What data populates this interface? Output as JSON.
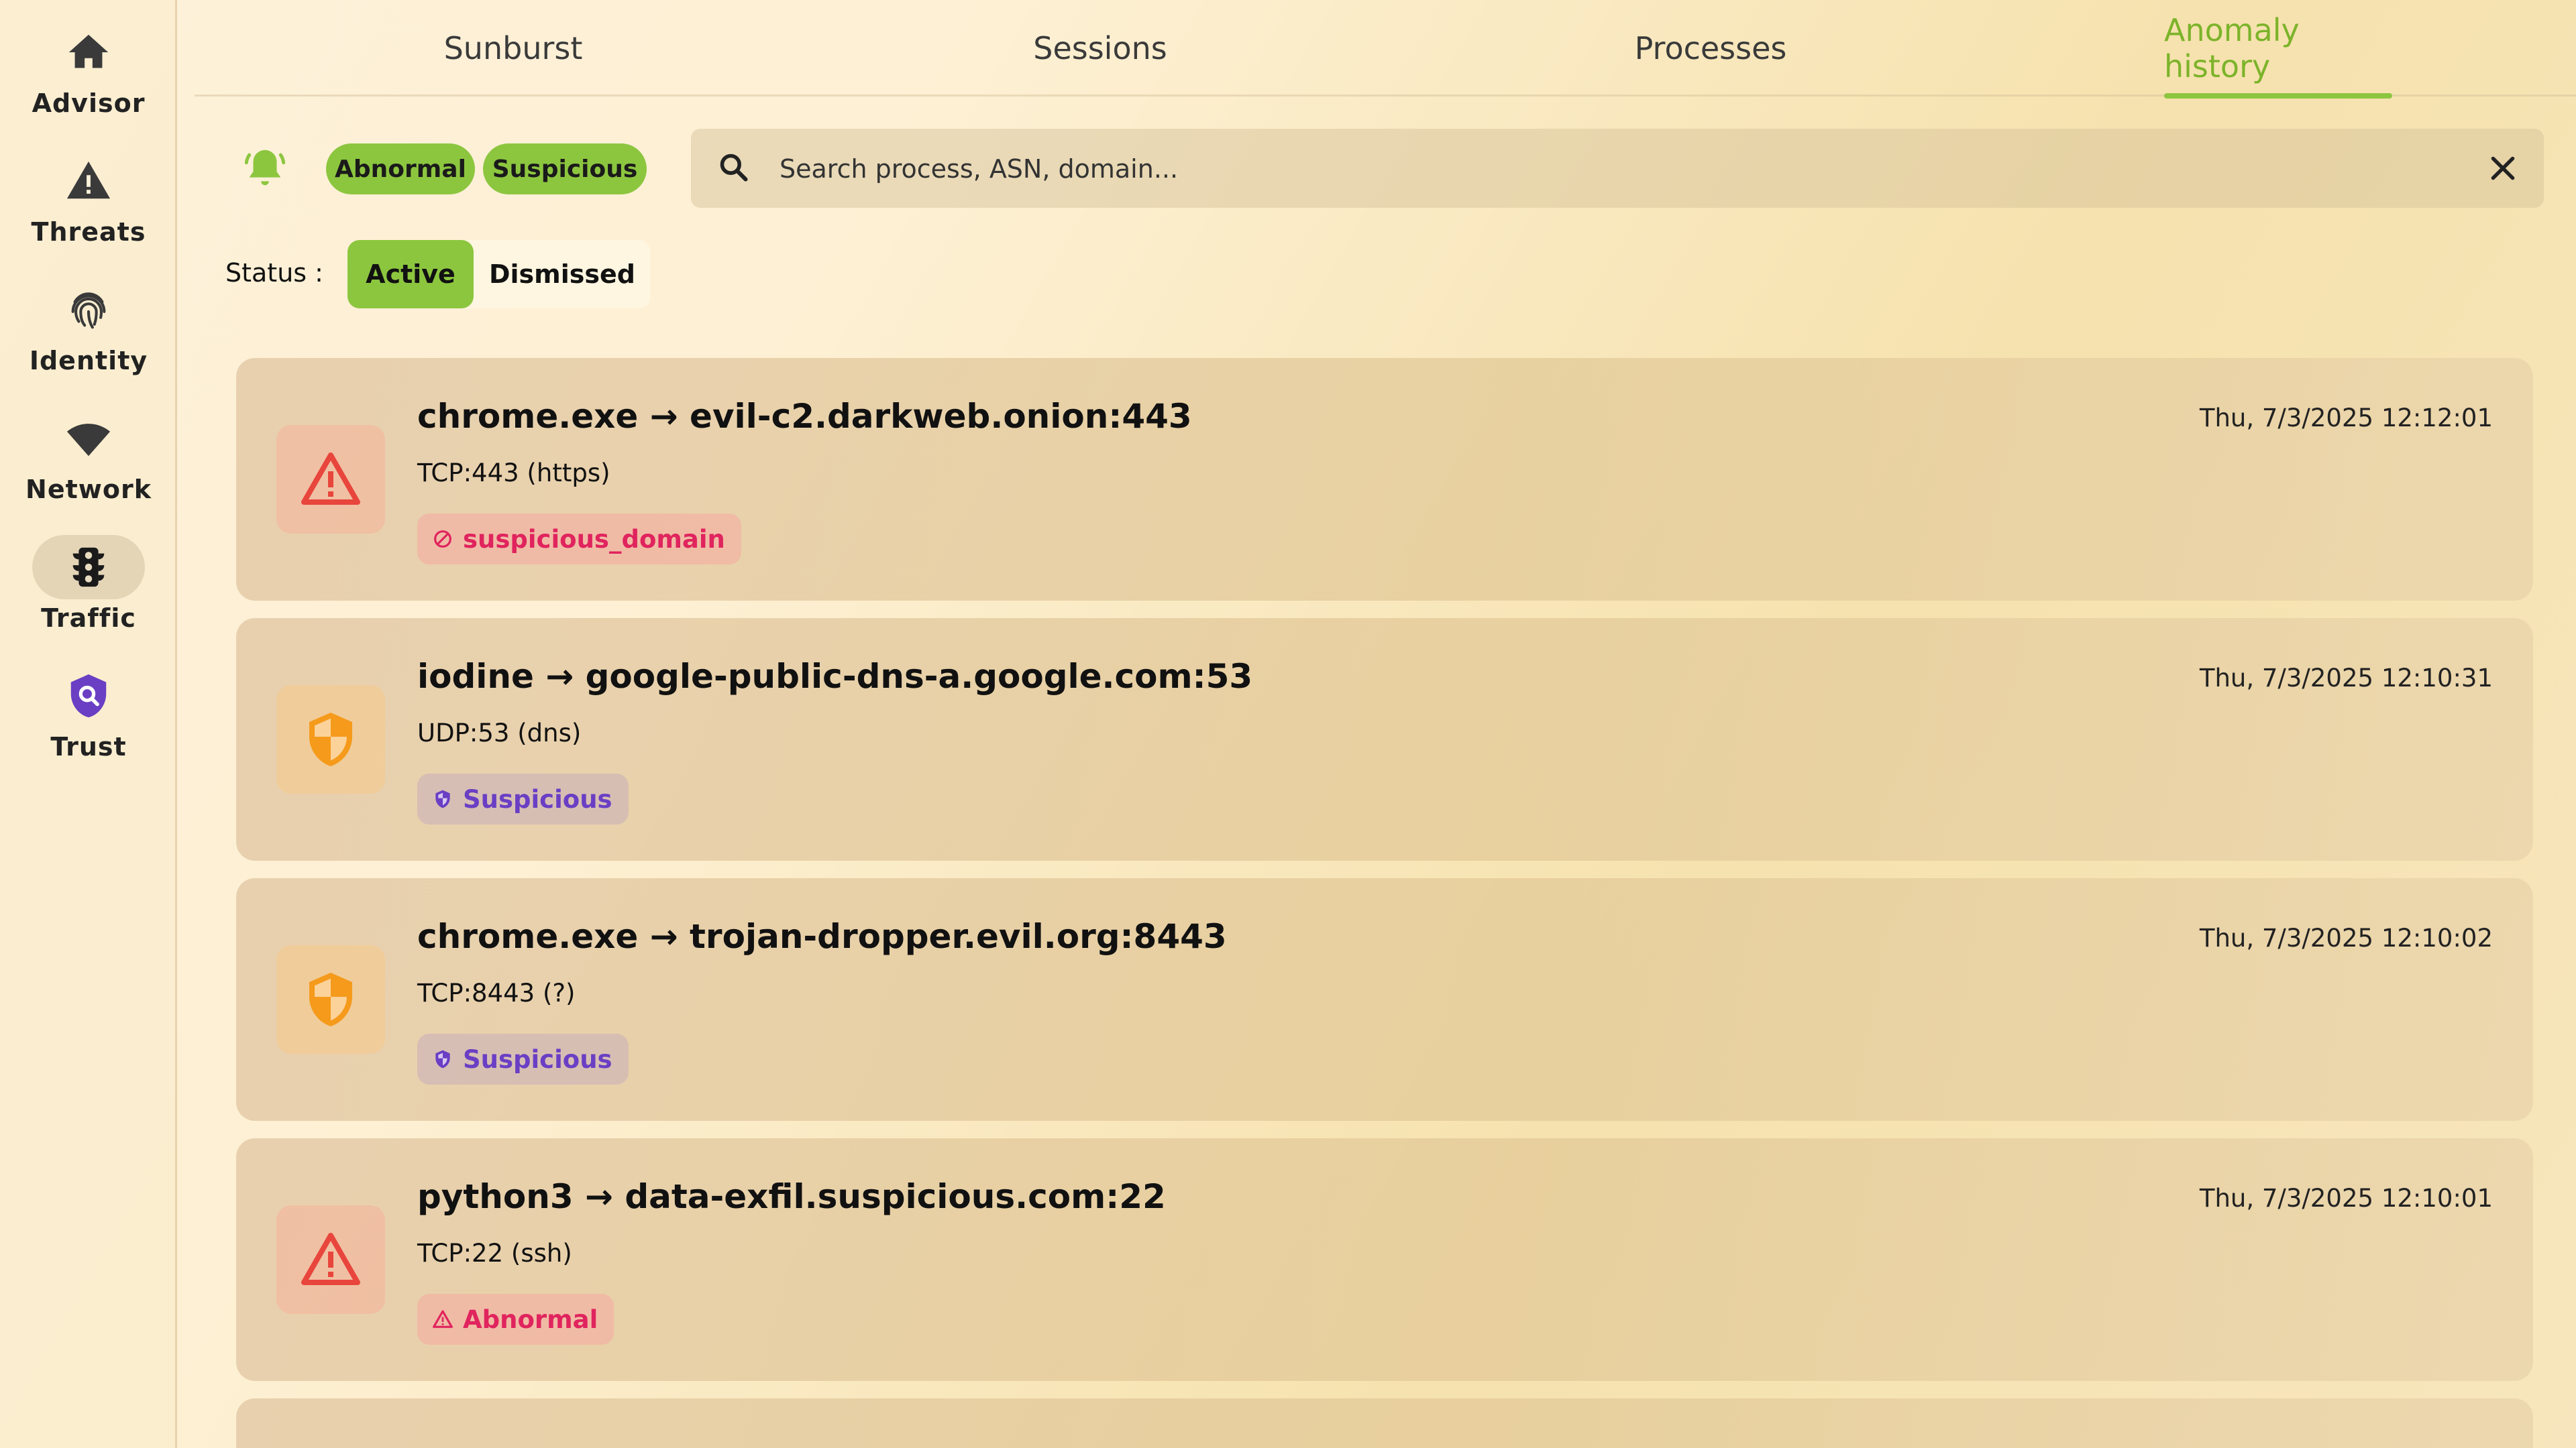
{
  "sidebar": {
    "items": [
      {
        "label": "Advisor",
        "icon": "home-icon"
      },
      {
        "label": "Threats",
        "icon": "warning-icon"
      },
      {
        "label": "Identity",
        "icon": "fingerprint-icon"
      },
      {
        "label": "Network",
        "icon": "wifi-icon"
      },
      {
        "label": "Traffic",
        "icon": "traffic-light-icon",
        "active": true
      },
      {
        "label": "Trust",
        "icon": "shield-search-icon"
      }
    ]
  },
  "tabs": [
    {
      "label": "Sunburst"
    },
    {
      "label": "Sessions"
    },
    {
      "label": "Processes"
    },
    {
      "label": "Anomaly history",
      "active": true
    }
  ],
  "filters": {
    "chips": [
      "Abnormal",
      "Suspicious"
    ],
    "search_placeholder": "Search process, ASN, domain..."
  },
  "status": {
    "label": "Status :",
    "options": [
      "Active",
      "Dismissed"
    ],
    "selected": "Active"
  },
  "anomalies": [
    {
      "title": "chrome.exe → evil-c2.darkweb.onion:443",
      "protocol": "TCP:443 (https)",
      "time": "Thu, 7/3/2025 12:12:01",
      "badge": "suspicious_domain",
      "severity": "danger"
    },
    {
      "title": "iodine → google-public-dns-a.google.com:53",
      "protocol": "UDP:53 (dns)",
      "time": "Thu, 7/3/2025 12:10:31",
      "badge": "Suspicious",
      "severity": "warn"
    },
    {
      "title": "chrome.exe → trojan-dropper.evil.org:8443",
      "protocol": "TCP:8443 (?)",
      "time": "Thu, 7/3/2025 12:10:02",
      "badge": "Suspicious",
      "severity": "warn"
    },
    {
      "title": "python3 → data-exfil.suspicious.com:22",
      "protocol": "TCP:22 (ssh)",
      "time": "Thu, 7/3/2025 12:10:01",
      "badge": "Abnormal",
      "severity": "danger"
    }
  ],
  "colors": {
    "accent": "#8cc63f",
    "danger": "#e0245e",
    "warning": "#f59a1b",
    "trust": "#6a3fc4"
  }
}
